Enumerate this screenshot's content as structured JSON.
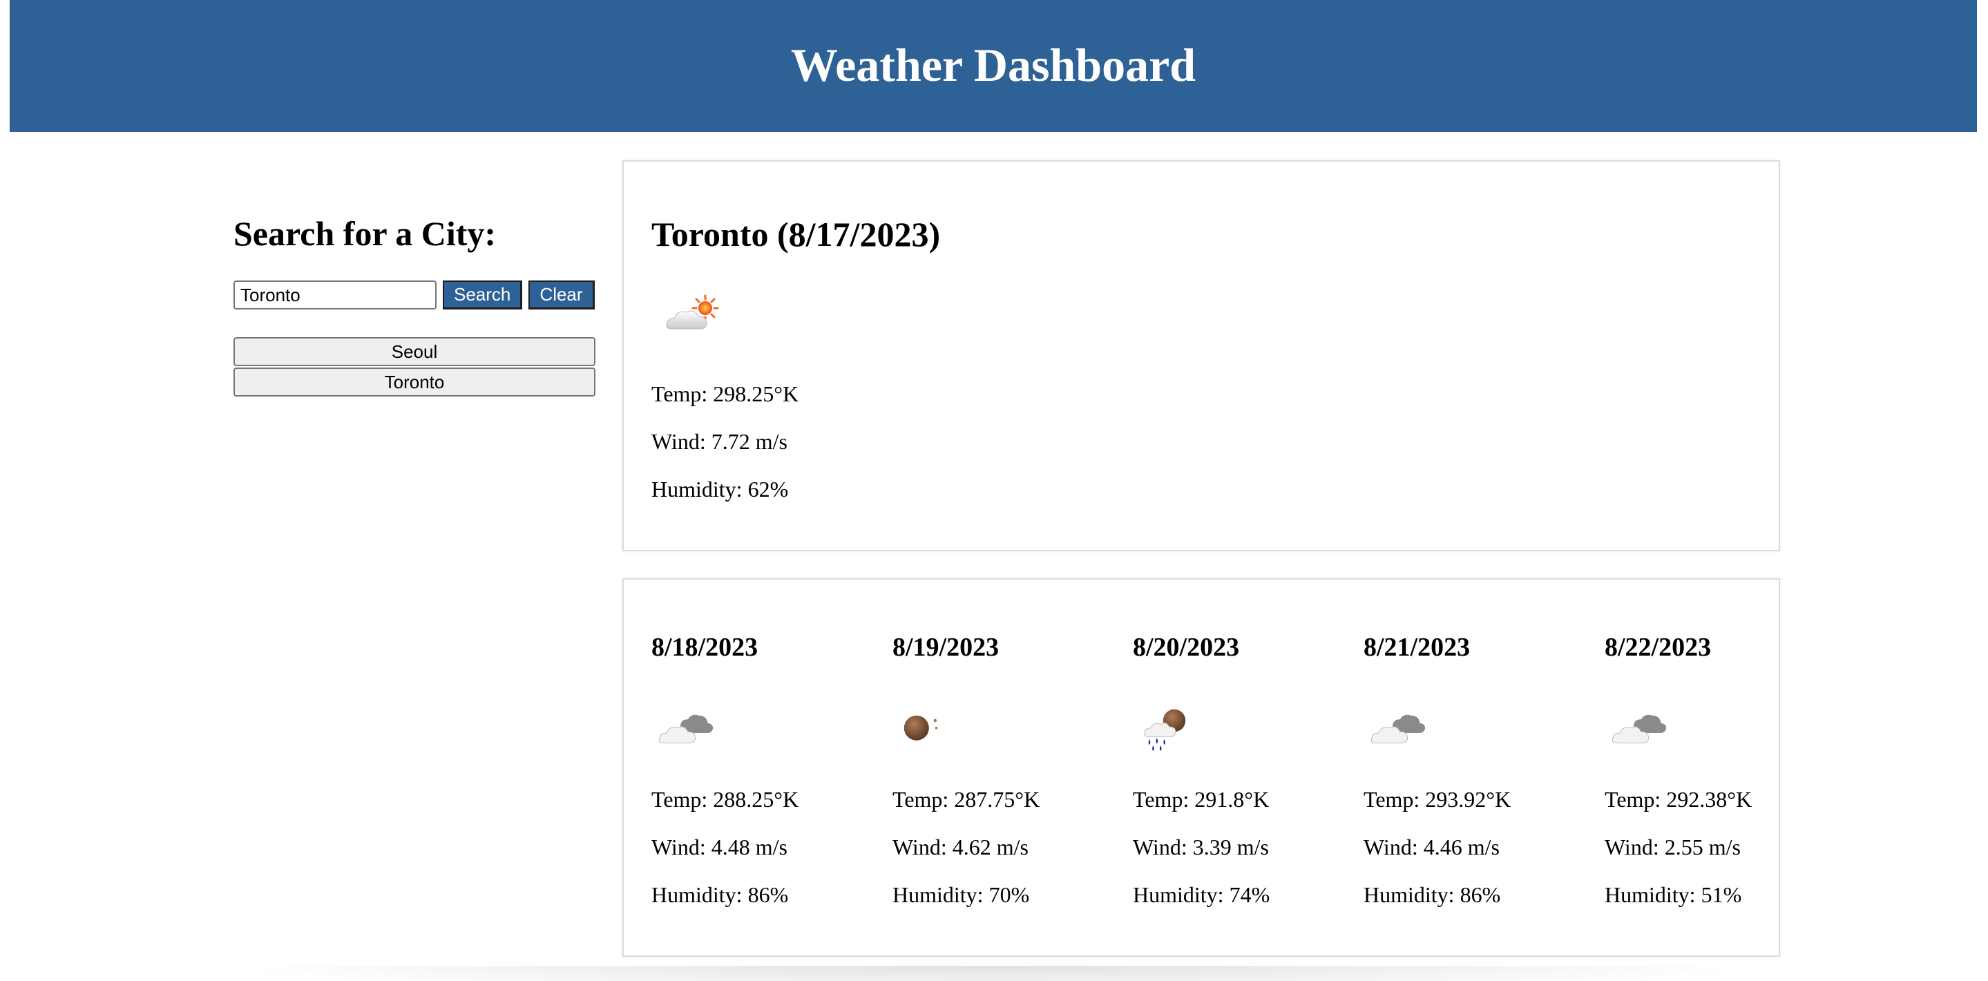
{
  "header": {
    "title": "Weather Dashboard"
  },
  "sidebar": {
    "heading": "Search for a City:",
    "search": {
      "value": "Toronto",
      "placeholder": ""
    },
    "search_label": "Search",
    "clear_label": "Clear",
    "history": [
      {
        "label": "Seoul"
      },
      {
        "label": "Toronto"
      }
    ]
  },
  "current": {
    "title": "Toronto (8/17/2023)",
    "icon": "few-clouds-day-icon",
    "temp": "Temp: 298.25°K",
    "wind": "Wind: 7.72 m/s",
    "humidity": "Humidity: 62%"
  },
  "forecast": [
    {
      "date": "8/18/2023",
      "icon": "broken-clouds-icon",
      "temp": "Temp: 288.25°K",
      "wind": "Wind: 4.48 m/s",
      "humidity": "Humidity: 86%"
    },
    {
      "date": "8/19/2023",
      "icon": "clear-night-icon",
      "temp": "Temp: 287.75°K",
      "wind": "Wind: 4.62 m/s",
      "humidity": "Humidity: 70%"
    },
    {
      "date": "8/20/2023",
      "icon": "rain-night-icon",
      "temp": "Temp: 291.8°K",
      "wind": "Wind: 3.39 m/s",
      "humidity": "Humidity: 74%"
    },
    {
      "date": "8/21/2023",
      "icon": "broken-clouds-icon",
      "temp": "Temp: 293.92°K",
      "wind": "Wind: 4.46 m/s",
      "humidity": "Humidity: 86%"
    },
    {
      "date": "8/22/2023",
      "icon": "broken-clouds-icon",
      "temp": "Temp: 292.38°K",
      "wind": "Wind: 2.55 m/s",
      "humidity": "Humidity: 51%"
    }
  ],
  "colors": {
    "header_bg": "#2e6196",
    "button_bg": "#2e6196",
    "history_bg": "#efefef"
  }
}
